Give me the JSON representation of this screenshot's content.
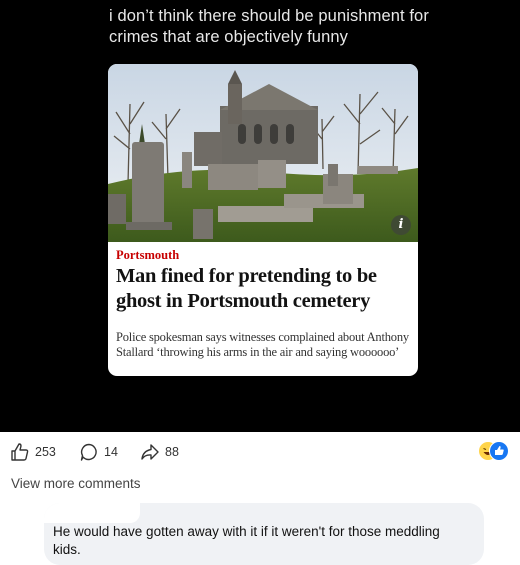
{
  "post": {
    "caption": "i don’t think there should be punishment for crimes that are objectively funny"
  },
  "article": {
    "kicker": "Portsmouth",
    "headline": "Man fined for pretending to be ghost in Portsmouth cemetery",
    "standfirst": "Police spokesman says witnesses complained about Anthony Stallard ‘throwing his arms in the air and saying woooooo’",
    "info_badge": "i"
  },
  "reactions": {
    "likes": "253",
    "comments": "14",
    "shares": "88",
    "icons": [
      "like-icon",
      "comment-icon",
      "share-icon",
      "haha-reaction-icon",
      "like-reaction-icon"
    ]
  },
  "comments_section": {
    "view_more_label": "View more comments",
    "comments": [
      {
        "text": "He would have gotten away with it if it weren't for those meddling kids."
      }
    ]
  },
  "colors": {
    "media_background": "#000000",
    "kicker_red": "#c70000",
    "bubble_bg": "#f0f2f5",
    "like_blue": "#1877f2"
  }
}
